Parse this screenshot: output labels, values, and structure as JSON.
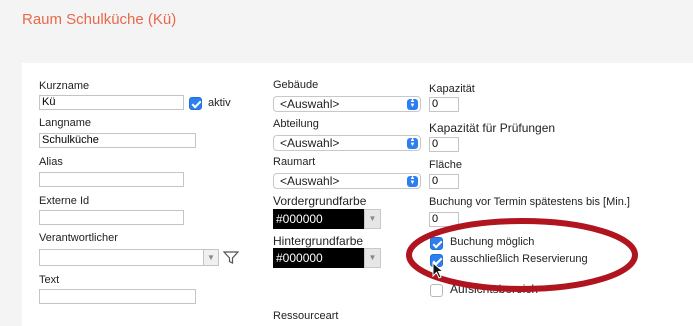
{
  "title": "Raum Schulküche (Kü)",
  "col1": {
    "kurzname_label": "Kurzname",
    "kurzname_value": "Kü",
    "aktiv_label": "aktiv",
    "langname_label": "Langname",
    "langname_value": "Schulküche",
    "alias_label": "Alias",
    "alias_value": "",
    "externe_id_label": "Externe Id",
    "externe_id_value": "",
    "verantwortlicher_label": "Verantwortlicher",
    "verantwortlicher_value": "",
    "text_label": "Text",
    "text_value": ""
  },
  "col2": {
    "gebaeude_label": "Gebäude",
    "gebaeude_value": "<Auswahl>",
    "abteilung_label": "Abteilung",
    "abteilung_value": "<Auswahl>",
    "raumart_label": "Raumart",
    "raumart_value": "<Auswahl>",
    "vordergrundfarbe_label": "Vordergrundfarbe",
    "vordergrundfarbe_value": "#000000",
    "hintergrundfarbe_label": "Hintergrundfarbe",
    "hintergrundfarbe_value": "#000000",
    "ressourceart_label": "Ressourceart"
  },
  "col3": {
    "kapazitaet_label": "Kapazität",
    "kapazitaet_value": "0",
    "kapazitaet_pruefungen_label": "Kapazität für Prüfungen",
    "kapazitaet_pruefungen_value": "0",
    "flaeche_label": "Fläche",
    "flaeche_value": "0",
    "buchung_termin_label": "Buchung vor Termin spätestens bis [Min.]",
    "buchung_termin_value": "0",
    "buchung_moeglich_label": "Buchung möglich",
    "reservierung_label": "ausschließlich Reservierung",
    "aufsichtsbereich_label": "Aufsichtsbereich"
  },
  "checkbox_states": {
    "aktiv": true,
    "buchung_moeglich": true,
    "reservierung": true,
    "aufsichtsbereich": false
  },
  "colors": {
    "title": "#e8694a",
    "checkbox_accent": "#2d7ff0",
    "highlight_ellipse": "#b0141e"
  }
}
